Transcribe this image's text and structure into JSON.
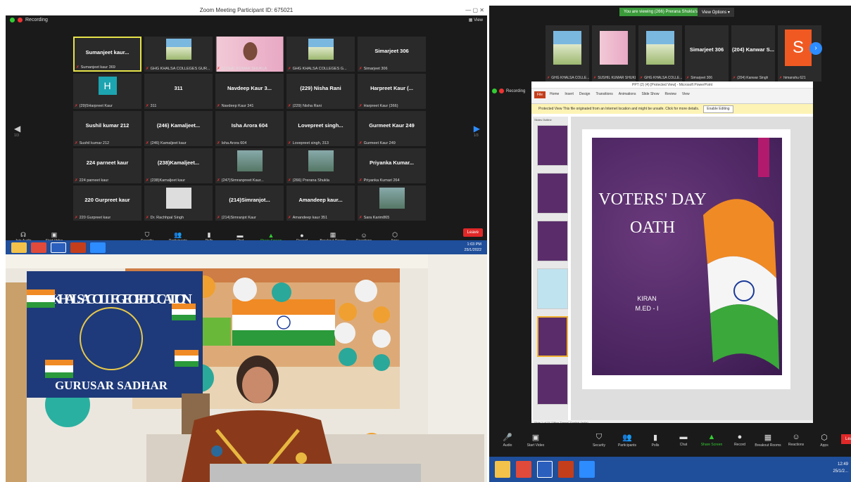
{
  "left_window": {
    "title": "Zoom Meeting Participant ID: 675021",
    "recording": "Recording",
    "view": "View",
    "page_left": "1/3",
    "page_right": "1/3",
    "tiles": [
      {
        "name": "Sumanjeet  kaur...",
        "caption": "Sumanjeet kaur 369",
        "kind": "text",
        "selected": true
      },
      {
        "name": "",
        "caption": "GHG KHALSA COLLEGES GUR...",
        "kind": "building"
      },
      {
        "name": "",
        "caption": "SUSHIL KUMAR SHUKLA",
        "kind": "pink"
      },
      {
        "name": "",
        "caption": "GHG KHALSA COLLEGES G...",
        "kind": "building"
      },
      {
        "name": "Simarjeet 306",
        "caption": "Simarjeet 306",
        "kind": "text"
      },
      {
        "name": "H",
        "caption": "(29)5Harpreet Kaur",
        "kind": "h"
      },
      {
        "name": "311",
        "caption": "311",
        "kind": "text"
      },
      {
        "name": "Navdeep Kaur 3...",
        "caption": "Navdeep Kaur 341",
        "kind": "text"
      },
      {
        "name": "(229) Nisha Rani",
        "caption": "(229) Nisha Rani",
        "kind": "text"
      },
      {
        "name": "Harpreet Kaur (...",
        "caption": "Harpreet Kaur (366)",
        "kind": "text"
      },
      {
        "name": "Sushil kumar 212",
        "caption": "Sushil kumar 212",
        "kind": "text"
      },
      {
        "name": "(246) Kamaljeet...",
        "caption": "(246) Kamaljeet kaur",
        "kind": "text"
      },
      {
        "name": "Isha Arora 604",
        "caption": "Isha Arora 604",
        "kind": "text"
      },
      {
        "name": "Lovepreet  singh...",
        "caption": "Lovepreet singh, 313",
        "kind": "text"
      },
      {
        "name": "Gurmeet Kaur 249",
        "caption": "Gurmeet Kaur 249",
        "kind": "text"
      },
      {
        "name": "224 parneet kaur",
        "caption": "224 parneet kaur",
        "kind": "text"
      },
      {
        "name": "(238)Kamaljeet...",
        "caption": "(238)Kamaljeet kaur",
        "kind": "text"
      },
      {
        "name": "",
        "caption": "(247)Simranpreet Kaur...",
        "kind": "picture"
      },
      {
        "name": "",
        "caption": "(266) Prerana Shukla",
        "kind": "picture"
      },
      {
        "name": "Priyanka  Kumar...",
        "caption": "Priyanka Kumari 264",
        "kind": "text"
      },
      {
        "name": "220 Gurpreet kaur",
        "caption": "220 Gurpreet kaur",
        "kind": "text"
      },
      {
        "name": "",
        "caption": "Dr. Rachhpal Singh",
        "kind": "avatar"
      },
      {
        "name": "(214)Simranjot...",
        "caption": "(214)Simranjot Kaur",
        "kind": "text"
      },
      {
        "name": "Amandeep  kaur...",
        "caption": "Amandeep kaur 351",
        "kind": "text"
      },
      {
        "name": "",
        "caption": "Sara Karim865",
        "kind": "picture"
      }
    ],
    "toolbar": [
      {
        "label": "Join Audio",
        "icon": "☊"
      },
      {
        "label": "Start Video",
        "icon": "▣"
      },
      {
        "label": "Security",
        "icon": "⛉"
      },
      {
        "label": "Participants",
        "icon": "👥"
      },
      {
        "label": "Polls",
        "icon": "▮"
      },
      {
        "label": "Chat",
        "icon": "▬"
      },
      {
        "label": "Share Screen",
        "icon": "▲"
      },
      {
        "label": "Record",
        "icon": "●"
      },
      {
        "label": "Breakout Rooms",
        "icon": "▦"
      },
      {
        "label": "Reactions",
        "icon": "☺"
      },
      {
        "label": "Apps",
        "icon": "⬡"
      }
    ],
    "participants_count": "65",
    "leave": "Leave",
    "clock_time": "1:03 PM",
    "clock_date": "25/1/2022"
  },
  "right_window": {
    "viewing_banner": "You are viewing (266) Prerana Shukla's screen",
    "view_options": "View Options",
    "recording": "Recording",
    "strip": [
      {
        "name": "",
        "caption": "GHG KHALSA COLLE...",
        "kind": "building"
      },
      {
        "name": "",
        "caption": "SUSHIL KUMAR SHUKLA",
        "kind": "pink"
      },
      {
        "name": "",
        "caption": "GHG KHALSA COLLE...",
        "kind": "building"
      },
      {
        "name": "Simarjeet 306",
        "caption": "Simarjeet 306",
        "kind": "text"
      },
      {
        "name": "(204) Kanwar S...",
        "caption": "(204) Kanwar Singh",
        "kind": "text"
      },
      {
        "name": "S",
        "caption": "himanshu 621",
        "kind": "s"
      }
    ],
    "ppt": {
      "title": "PPT (2) (4) [Protected View] - Microsoft PowerPoint",
      "file": "File",
      "menu": [
        "Home",
        "Insert",
        "Design",
        "Transitions",
        "Animations",
        "Slide Show",
        "Review",
        "View"
      ],
      "protected": "Protected View   This file originated from an Internet location and might be unsafe. Click for more details.",
      "enable": "Enable Editing",
      "tabs": "Slides   Outline",
      "slide_title": "VOTERS' DAY OATH",
      "slide_title_line1": "VOTERS' DAY",
      "slide_title_line2": "OATH",
      "author_line1": "KIRAN",
      "author_line2": "M.ED - I",
      "status": "Slide 1 of 15   \"Office Theme\"   English (India)"
    },
    "toolbar": [
      {
        "label": "Audio",
        "icon": "🎤"
      },
      {
        "label": "Start Video",
        "icon": "▣"
      },
      {
        "label": "Security",
        "icon": "⛉"
      },
      {
        "label": "Participants",
        "icon": "👥"
      },
      {
        "label": "Polls",
        "icon": "▮"
      },
      {
        "label": "Chat",
        "icon": "▬"
      },
      {
        "label": "Share Screen",
        "icon": "▲"
      },
      {
        "label": "Record",
        "icon": "●"
      },
      {
        "label": "Breakout Rooms",
        "icon": "▦"
      },
      {
        "label": "Reactions",
        "icon": "☺"
      },
      {
        "label": "Apps",
        "icon": "⬡"
      }
    ],
    "leave": "Leave",
    "clock_time": "12:49",
    "clock_date": "25/1/2..."
  },
  "photo": {
    "banner_line1": "GHG KHALSA COLLEGE OF EDUCATION",
    "banner_line2": "GURUSAR SADHAR"
  },
  "colors": {
    "zoom_blue": "#2d8cff",
    "leave_red": "#e02828",
    "taskbar": "#1f4e9a"
  }
}
